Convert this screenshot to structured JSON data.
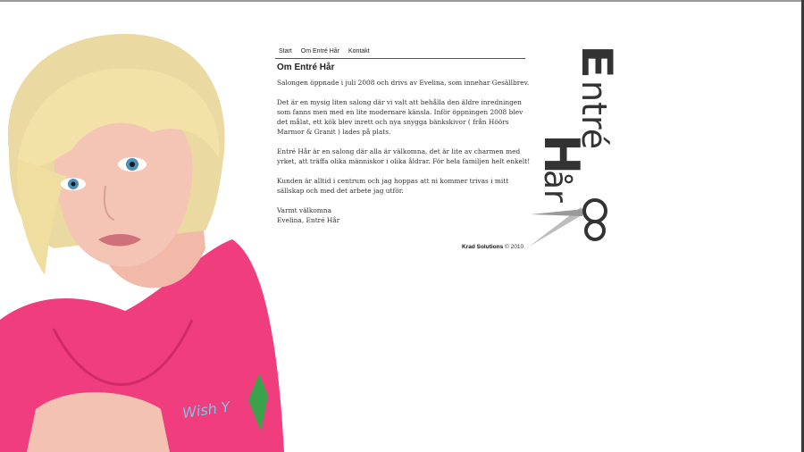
{
  "nav": {
    "items": [
      "Start",
      "Om Entré Hår",
      "Kontakt"
    ]
  },
  "page": {
    "heading": "Om Entré Hår",
    "paragraphs": [
      "Salongen öppnade i juli 2008 och drivs av Evelina, som innehar Gesällbrev.",
      "Det är en mysig liten salong där vi valt att behålla den äldre inredningen som fanns men med en lite modernare känsla. Inför öppningen 2008 blev det målat, ett kök blev inrett och nya snygga bänkskivor ( från Höörs Marmor & Granit ) lades på plats.",
      "Entré Hår är en salong där alla är välkomna, det är lite av charmen med yrket, att träffa olika människor i olika åldrar. För hela familjen helt enkelt!",
      "Kunden är alltid i centrum och jag hoppas att ni kommer trivas i mitt sällskap och med det arbete jag utför."
    ],
    "signoff": [
      "Varmt välkomna",
      "Evelina, Entré Hår"
    ]
  },
  "footer": {
    "company": "Krad Solutions",
    "copyright": "© 2010"
  },
  "logo": {
    "line1": "Entré",
    "line2": "Hår"
  },
  "colors": {
    "accent_pink": "#ef3d7e",
    "hair_blonde": "#f2e2a8",
    "text": "#333333"
  }
}
